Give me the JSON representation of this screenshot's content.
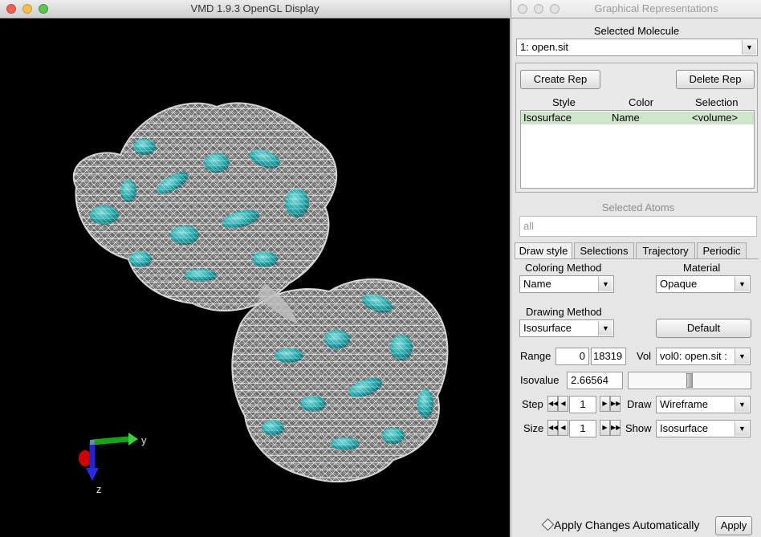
{
  "gl_window": {
    "title": "VMD 1.9.3 OpenGL Display",
    "axes": {
      "y_label": "y",
      "z_label": "z"
    }
  },
  "rep_window": {
    "title": "Graphical Representations",
    "selected_molecule_label": "Selected Molecule",
    "selected_molecule_value": "1: open.sit",
    "create_rep": "Create Rep",
    "delete_rep": "Delete Rep",
    "columns": [
      "Style",
      "Color",
      "Selection"
    ],
    "reps": [
      {
        "style": "Isosurface",
        "color": "Name",
        "selection": "<volume>"
      }
    ],
    "selected_atoms_label": "Selected Atoms",
    "selected_atoms_value": "all",
    "tabs": [
      "Draw style",
      "Selections",
      "Trajectory",
      "Periodic"
    ],
    "coloring_method_label": "Coloring Method",
    "coloring_method_value": "Name",
    "material_label": "Material",
    "material_value": "Opaque",
    "drawing_method_label": "Drawing Method",
    "drawing_method_value": "Isosurface",
    "default_button": "Default",
    "range_label": "Range",
    "range_min": "0",
    "range_max": "18319",
    "vol_label": "Vol",
    "vol_value": "vol0: open.sit :",
    "isovalue_label": "Isovalue",
    "isovalue_value": "2.66564",
    "isovalue_slider_fraction": 0.5,
    "step_label": "Step",
    "step_value": "1",
    "draw_label": "Draw",
    "draw_value": "Wireframe",
    "size_label": "Size",
    "size_value": "1",
    "show_label": "Show",
    "show_value": "Isosurface",
    "apply_auto_label": "Apply Changes Automatically",
    "apply_button": "Apply"
  }
}
